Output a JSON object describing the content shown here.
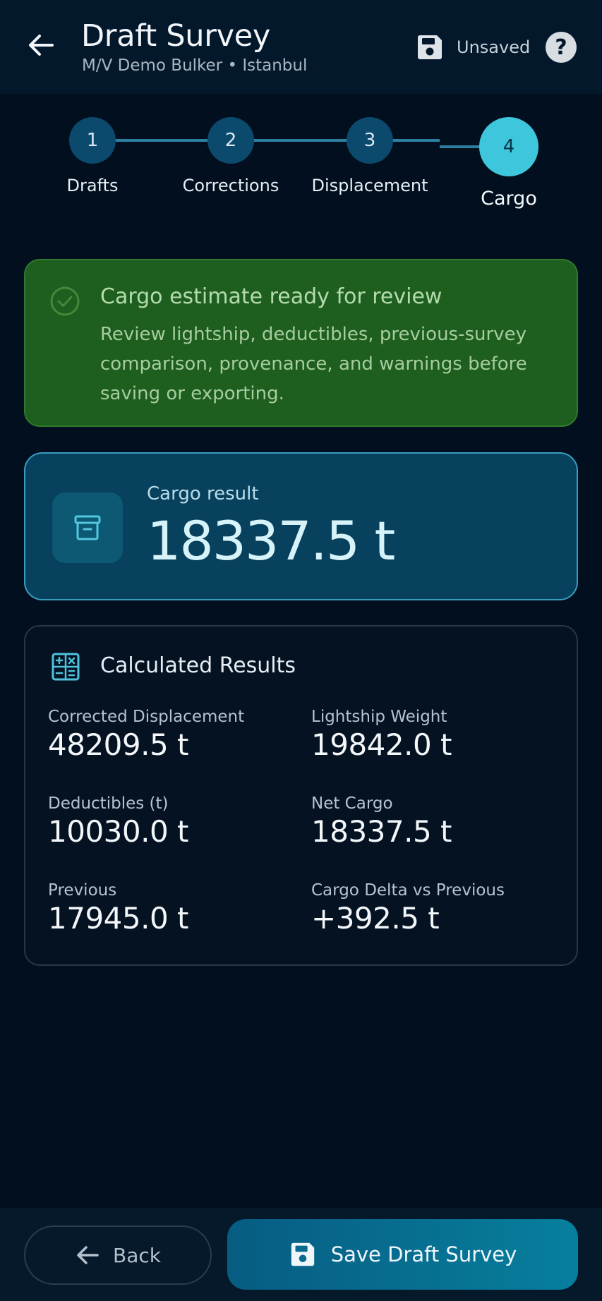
{
  "header": {
    "title": "Draft Survey",
    "subtitle": "M/V Demo Bulker • Istanbul",
    "save_status": "Unsaved",
    "help_glyph": "?"
  },
  "stepper": {
    "steps": [
      {
        "number": "1",
        "label": "Drafts",
        "state": "done"
      },
      {
        "number": "2",
        "label": "Corrections",
        "state": "done"
      },
      {
        "number": "3",
        "label": "Displacement",
        "state": "done"
      },
      {
        "number": "4",
        "label": "Cargo",
        "state": "active"
      }
    ]
  },
  "banner": {
    "title": "Cargo estimate ready for review",
    "text": "Review lightship, deductibles, previous-survey comparison, provenance, and warnings before saving or exporting."
  },
  "result": {
    "label": "Cargo result",
    "value": "18337.5 t"
  },
  "calculated": {
    "title": "Calculated Results",
    "metrics": [
      {
        "label": "Corrected Displacement",
        "value": "48209.5 t"
      },
      {
        "label": "Lightship Weight",
        "value": "19842.0 t"
      },
      {
        "label": "Deductibles (t)",
        "value": "10030.0 t"
      },
      {
        "label": "Net Cargo",
        "value": "18337.5 t"
      },
      {
        "label": "Previous",
        "value": "17945.0 t"
      },
      {
        "label": "Cargo Delta vs Previous",
        "value": "+392.5 t"
      }
    ]
  },
  "bottom": {
    "back_label": "Back",
    "save_label": "Save Draft Survey"
  },
  "colors": {
    "background": "#020f1e",
    "accent": "#3ec7dc",
    "success": "#1e5e1e",
    "primary": "#07415e"
  },
  "icons": {
    "back": "arrow-left-icon",
    "save": "floppy-disk-icon",
    "help": "question-circle-icon",
    "success": "check-circle-icon",
    "cargo": "archive-box-icon",
    "calculator": "calculator-icon"
  }
}
